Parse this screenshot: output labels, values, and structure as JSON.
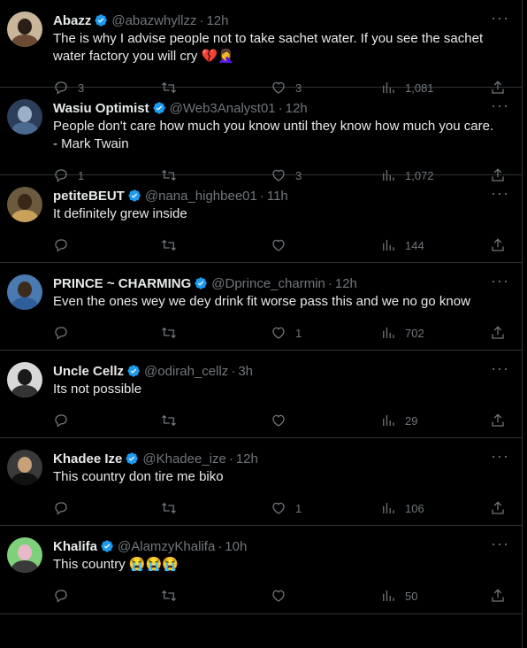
{
  "more_label": "···",
  "tweets": [
    {
      "name": "Abazz",
      "handle": "@abazwhyllzz",
      "time": "12h",
      "text": "The is why I advise people not to take sachet water. If you see the sachet water factory you will cry 💔🤦‍♀️",
      "replies": "3",
      "retweets": "",
      "likes": "3",
      "views": "1,081",
      "avatar_colors": [
        "#c8b59a",
        "#2a1f17",
        "#6a4a32"
      ]
    },
    {
      "name": "Wasiu Optimist",
      "handle": "@Web3Analyst01",
      "time": "12h",
      "text": "People don't care how much you know until they know how much you care.\n- Mark Twain",
      "replies": "1",
      "retweets": "",
      "likes": "3",
      "views": "1,072",
      "avatar_colors": [
        "#2c3e5a",
        "#9ab0c8",
        "#4a6a90"
      ]
    },
    {
      "name": "petiteBEUT",
      "handle": "@nana_highbee01",
      "time": "11h",
      "text": "It definitely grew inside",
      "replies": "",
      "retweets": "",
      "likes": "",
      "views": "144",
      "avatar_colors": [
        "#6b5a3e",
        "#3a2718",
        "#c9a25a"
      ]
    },
    {
      "name": "PRINCE ~ CHARMING",
      "handle": "@Dprince_charmin",
      "time": "12h",
      "text": "Even the ones wey we dey drink fit worse pass this and we no go know",
      "replies": "",
      "retweets": "",
      "likes": "1",
      "views": "702",
      "avatar_colors": [
        "#4a7ab0",
        "#3b2a1e",
        "#2f5f9a"
      ]
    },
    {
      "name": "Uncle Cellz",
      "handle": "@odirah_cellz",
      "time": "3h",
      "text": "Its not possible",
      "replies": "",
      "retweets": "",
      "likes": "",
      "views": "29",
      "avatar_colors": [
        "#d8d8d8",
        "#1a1a1a",
        "#333333"
      ]
    },
    {
      "name": "Khadee Ize",
      "handle": "@Khadee_ize",
      "time": "12h",
      "text": "This country don tire me biko",
      "replies": "",
      "retweets": "",
      "likes": "1",
      "views": "106",
      "avatar_colors": [
        "#3a3a3a",
        "#c8a07a",
        "#111111"
      ]
    },
    {
      "name": "Khalifa",
      "handle": "@AlamzyKhalifa",
      "time": "10h",
      "text": "This country 😭😭😭",
      "replies": "",
      "retweets": "",
      "likes": "",
      "views": "50",
      "avatar_colors": [
        "#7ed07a",
        "#e8b8c8",
        "#3a3a3a"
      ]
    }
  ],
  "colors": {
    "verified": "#1d9bf0",
    "muted": "#71767b",
    "divider": "#2f3336",
    "text": "#e7e9ea"
  },
  "icons": [
    "reply-icon",
    "retweet-icon",
    "like-icon",
    "views-icon",
    "share-icon",
    "verified-icon",
    "more-icon"
  ]
}
